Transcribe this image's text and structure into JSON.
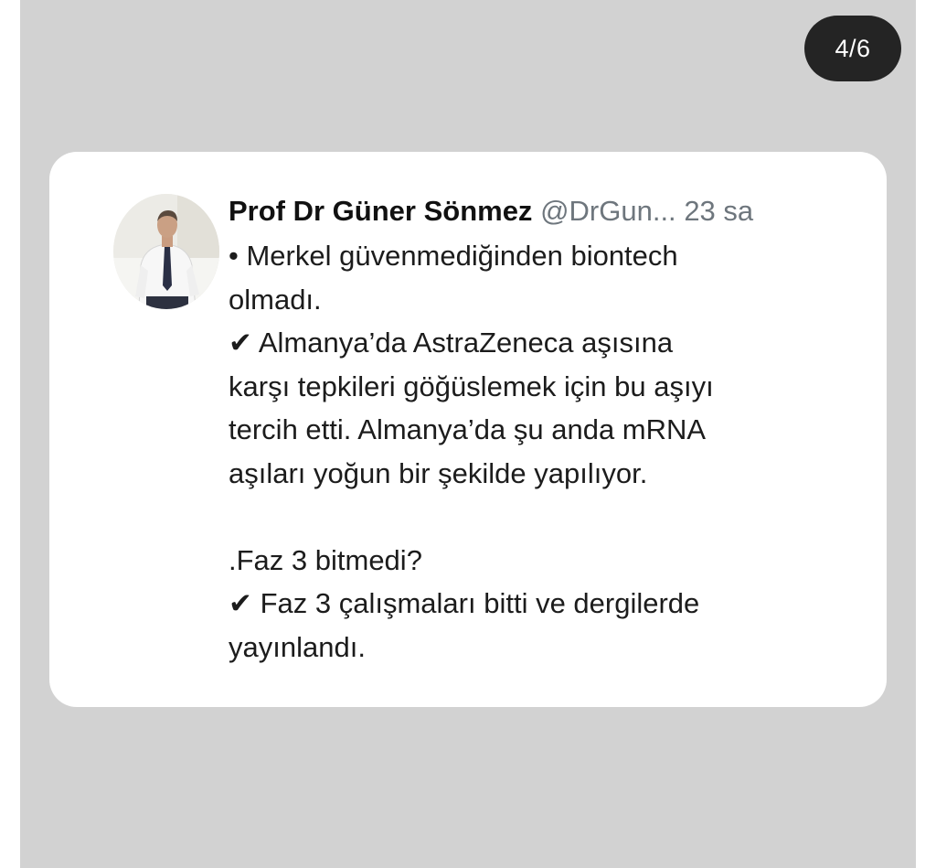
{
  "pager": {
    "label": "4/6"
  },
  "tweet": {
    "author_name": "Prof Dr Güner Sönmez",
    "handle": "@DrGun...",
    "timestamp": "23 sa",
    "lines": [
      "• Merkel güvenmediğinden biontech",
      "olmadı.",
      "✔ Almanya’da AstraZeneca aşısına",
      "karşı tepkileri göğüslemek için bu aşıyı",
      "tercih etti. Almanya’da şu anda mRNA",
      "aşıları yoğun bir şekilde yapılıyor.",
      "",
      ".Faz 3 bitmedi?",
      "✔ Faz 3 çalışmaları bitti ve dergilerde",
      "yayınlandı."
    ]
  },
  "colors": {
    "background": "#d2d2d2",
    "card": "#ffffff",
    "badge": "#242424",
    "handle_gray": "#6e767d"
  },
  "icons": {
    "avatar": "profile-photo"
  }
}
